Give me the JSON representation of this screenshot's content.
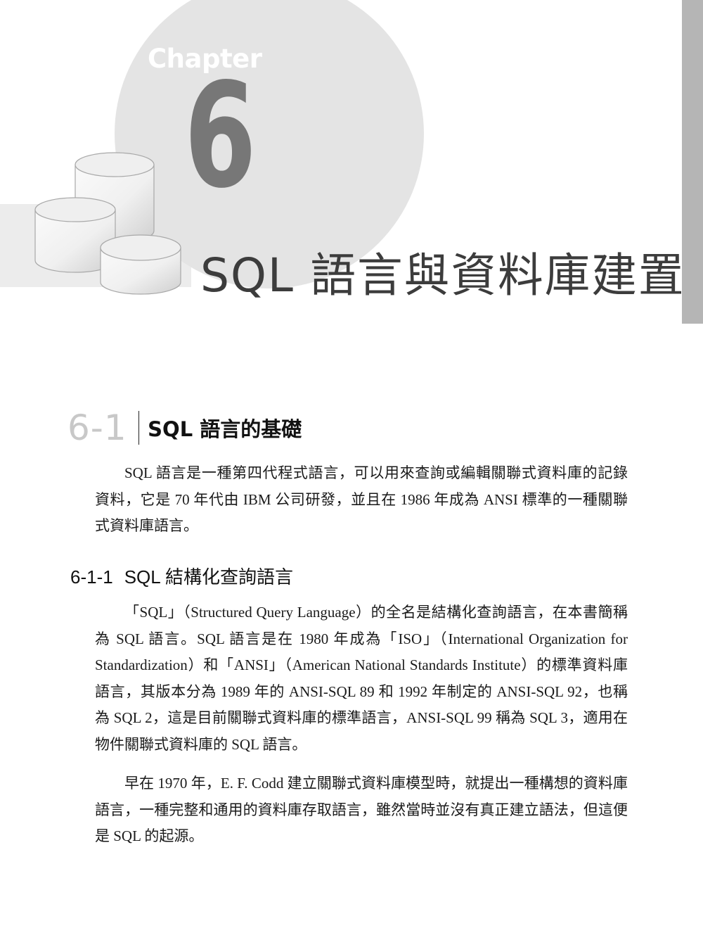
{
  "chapter": {
    "label": "Chapter",
    "number": "6",
    "title": "SQL 語言與資料庫建置"
  },
  "section": {
    "number": "6-1",
    "title": "SQL 語言的基礎",
    "paragraphs": [
      "SQL 語言是一種第四代程式語言，可以用來查詢或編輯關聯式資料庫的記錄資料，它是 70 年代由 IBM 公司研發，並且在 1986 年成為 ANSI 標準的一種關聯式資料庫語言。"
    ]
  },
  "subsection": {
    "number": "6-1-1",
    "title": "SQL 結構化查詢語言",
    "paragraphs": [
      "「SQL」（Structured Query Language）的全名是結構化查詢語言，在本書簡稱為 SQL 語言。SQL 語言是在 1980 年成為「ISO」（International Organization for Standardization）和「ANSI」（American National Standards Institute）的標準資料庫語言，其版本分為 1989 年的 ANSI-SQL 89 和 1992 年制定的 ANSI-SQL 92，也稱為 SQL 2，這是目前關聯式資料庫的標準語言，ANSI-SQL 99 稱為 SQL 3，適用在物件關聯式資料庫的 SQL 語言。",
      "早在 1970 年，E. F. Codd 建立關聯式資料庫模型時，就提出一種構想的資料庫語言，一種完整和通用的資料庫存取語言，雖然當時並沒有真正建立語法，但這便是 SQL 的起源。"
    ]
  },
  "decor": {
    "icon": "database-cylinders-icon",
    "colors": {
      "circle": "#e4e4e4",
      "band": "#ececec",
      "side_tab": "#b5b5b5",
      "chapter_number": "#777777",
      "section_number": "#c8c8c8"
    }
  }
}
